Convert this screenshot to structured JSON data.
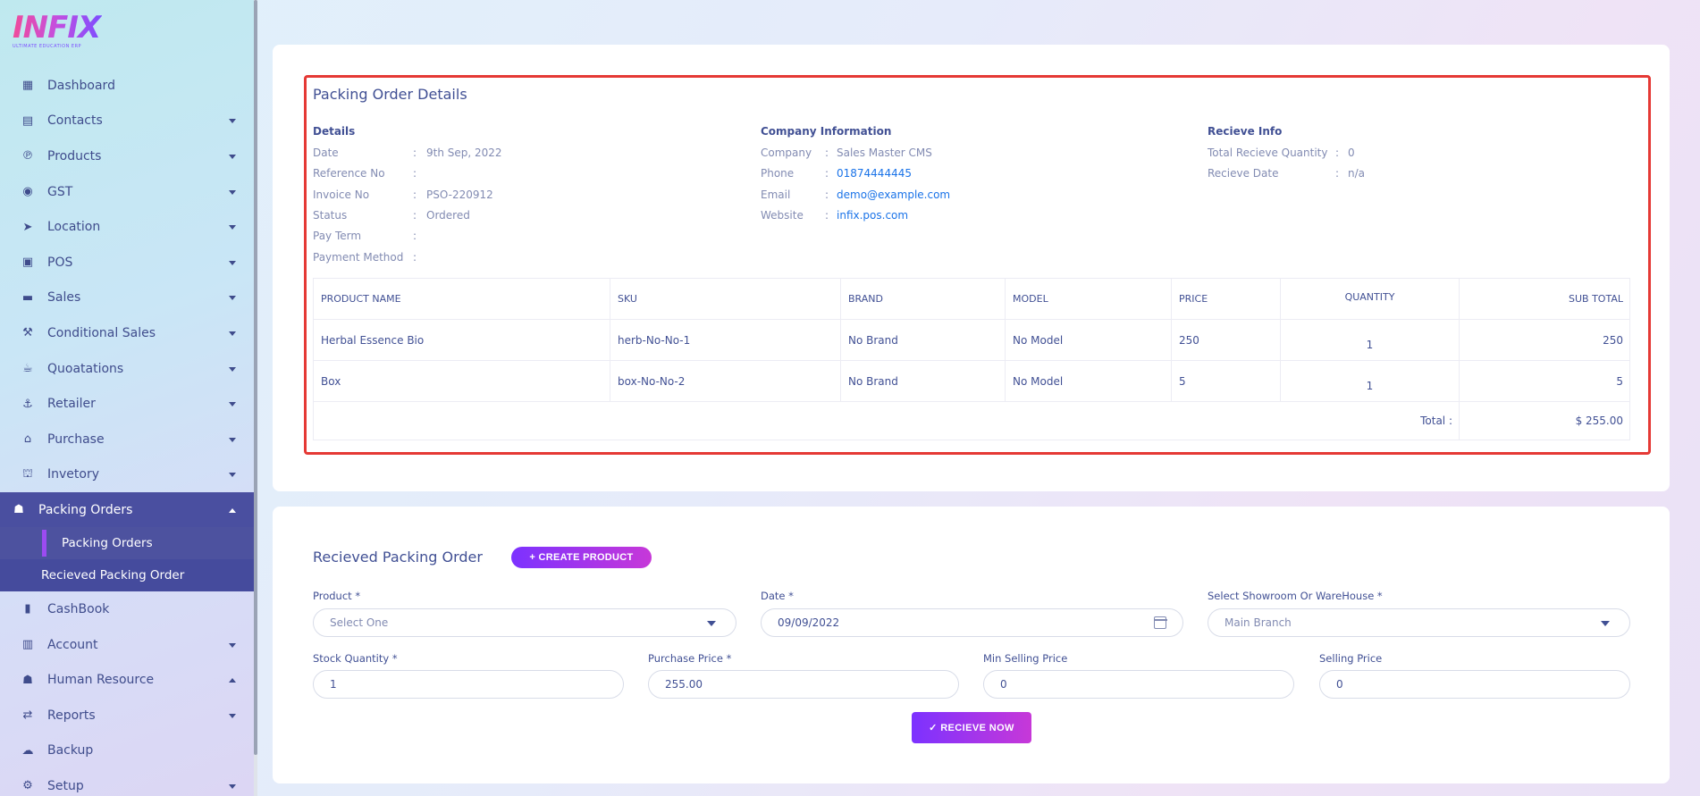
{
  "logo": {
    "word": "INFIX",
    "tagline": "ULTIMATE EDUCATION ERP"
  },
  "sidebar": {
    "items": [
      {
        "label": "Dashboard",
        "icon": "grid-icon",
        "glyph": "▦",
        "caret": ""
      },
      {
        "label": "Contacts",
        "icon": "contacts-icon",
        "glyph": "▤",
        "caret": "down"
      },
      {
        "label": "Products",
        "icon": "product-icon",
        "glyph": "℗",
        "caret": "down"
      },
      {
        "label": "GST",
        "icon": "gst-icon",
        "glyph": "◉",
        "caret": "down"
      },
      {
        "label": "Location",
        "icon": "location-arrow-icon",
        "glyph": "➤",
        "caret": "down"
      },
      {
        "label": "POS",
        "icon": "pos-icon",
        "glyph": "▣",
        "caret": "down"
      },
      {
        "label": "Sales",
        "icon": "sales-icon",
        "glyph": "▬",
        "caret": "down"
      },
      {
        "label": "Conditional Sales",
        "icon": "hammer-icon",
        "glyph": "⚒",
        "caret": "down"
      },
      {
        "label": "Quoatations",
        "icon": "quotation-icon",
        "glyph": "☕",
        "caret": "down"
      },
      {
        "label": "Retailer",
        "icon": "retailer-icon",
        "glyph": "⚓",
        "caret": "down"
      },
      {
        "label": "Purchase",
        "icon": "store-icon",
        "glyph": "⌂",
        "caret": "down"
      },
      {
        "label": "Invetory",
        "icon": "bank-icon",
        "glyph": "⛫",
        "caret": "down"
      }
    ],
    "active": {
      "label": "Packing Orders",
      "icon": "users-icon",
      "glyph": "☗"
    },
    "submenu": [
      {
        "label": "Packing Orders"
      },
      {
        "label": "Recieved Packing Order"
      }
    ],
    "after": [
      {
        "label": "CashBook",
        "icon": "book-icon",
        "glyph": "▮",
        "caret": ""
      },
      {
        "label": "Account",
        "icon": "account-icon",
        "glyph": "▥",
        "caret": "down"
      },
      {
        "label": "Human Resource",
        "icon": "users-icon",
        "glyph": "☗",
        "caret": "up"
      },
      {
        "label": "Reports",
        "icon": "reports-icon",
        "glyph": "⇄",
        "caret": "down"
      },
      {
        "label": "Backup",
        "icon": "cloud-download-icon",
        "glyph": "☁",
        "caret": ""
      },
      {
        "label": "Setup",
        "icon": "gear-icon",
        "glyph": "⚙",
        "caret": "down"
      }
    ]
  },
  "details": {
    "title": "Packing Order Details",
    "details_title": "Details",
    "details_rows": [
      {
        "label": "Date",
        "value": "9th Sep, 2022"
      },
      {
        "label": "Reference No",
        "value": ""
      },
      {
        "label": "Invoice No",
        "value": "PSO-220912"
      },
      {
        "label": "Status",
        "value": "Ordered"
      },
      {
        "label": "Pay Term",
        "value": ""
      },
      {
        "label": "Payment Method",
        "value": ""
      }
    ],
    "company_title": "Company Information",
    "company_rows": [
      {
        "label": "Company",
        "value": "Sales Master CMS",
        "link": false
      },
      {
        "label": "Phone",
        "value": "01874444445",
        "link": true
      },
      {
        "label": "Email",
        "value": "demo@example.com",
        "link": true
      },
      {
        "label": "Website",
        "value": "infix.pos.com",
        "link": true
      }
    ],
    "receive_title": "Recieve Info",
    "receive_rows": [
      {
        "label": "Total Recieve Quantity",
        "value": "0"
      },
      {
        "label": "Recieve Date",
        "value": "n/a"
      }
    ],
    "colon": ":"
  },
  "table": {
    "headers": [
      "PRODUCT NAME",
      "SKU",
      "BRAND",
      "MODEL",
      "PRICE",
      "QUANTITY",
      "SUB TOTAL"
    ],
    "rows": [
      {
        "name": "Herbal Essence Bio",
        "sku": "herb-No-No-1",
        "brand": "No Brand",
        "model": "No Model",
        "price": "250",
        "quantity": "1",
        "subtotal": "250"
      },
      {
        "name": "Box",
        "sku": "box-No-No-2",
        "brand": "No Brand",
        "model": "No Model",
        "price": "5",
        "quantity": "1",
        "subtotal": "5"
      }
    ],
    "total_label": "Total :",
    "total_value": "$ 255.00"
  },
  "form": {
    "title": "Recieved Packing Order",
    "create_label": "+ CREATE PRODUCT",
    "product_label": "Product *",
    "product_value": "Select One",
    "date_label": "Date *",
    "date_value": "09/09/2022",
    "warehouse_label": "Select Showroom Or WareHouse *",
    "warehouse_value": "Main Branch",
    "stock_label": "Stock Quantity *",
    "stock_value": "1",
    "purchase_label": "Purchase Price *",
    "purchase_value": "255.00",
    "min_label": "Min Selling Price",
    "min_value": "0",
    "selling_label": "Selling Price",
    "selling_value": "0",
    "submit_label": "✓ RECIEVE NOW"
  }
}
